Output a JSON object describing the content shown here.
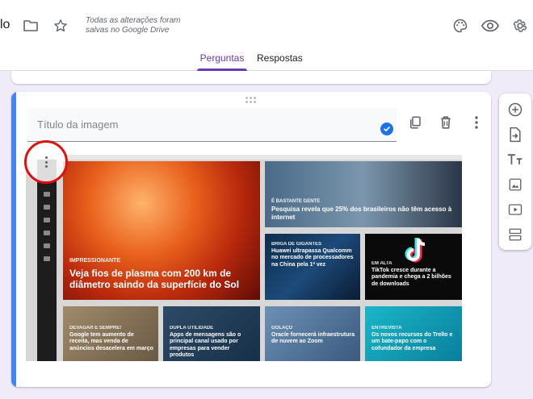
{
  "header": {
    "title_fragment": "lo",
    "save_status": "Todas as alterações foram salvas no Google Drive",
    "tabs": [
      {
        "label": "Perguntas",
        "active": true
      },
      {
        "label": "Respostas",
        "active": false
      }
    ],
    "accent_color": "#673ab7"
  },
  "card": {
    "title_placeholder": "Título da imagem",
    "accent_color": "#4285f4"
  },
  "image": {
    "tiles": [
      {
        "tag": "Impressionante",
        "headline": "Veja fios de plasma com 200 km de diâmetro saindo da superfície do Sol"
      },
      {
        "tag": "É bastante gente",
        "headline": "Pesquisa revela que 25% dos brasileiros não têm acesso à internet"
      },
      {
        "tag": "Briga de gigantes",
        "headline": "Huawei ultrapassa Qualcomm no mercado de processadores na China pela 1ª vez"
      },
      {
        "tag": "Em alta",
        "headline": "TikTok cresce durante a pandemia e chega a 2 bilhões de downloads"
      },
      {
        "tag": "Devagar e sempre!",
        "headline": "Google tem aumento de receita, mas venda de anúncios desacelera em março"
      },
      {
        "tag": "Dupla utilidade",
        "headline": "Apps de mensagens são o principal canal usado por empresas para vender produtos"
      },
      {
        "tag": "Golaço",
        "headline": "Oracle fornecerá infraestrutura de nuvem ao Zoom"
      },
      {
        "tag": "Entrevista",
        "headline": "Os novos recursos do Trello e um bate-papo com o cofundador da empresa"
      }
    ]
  }
}
